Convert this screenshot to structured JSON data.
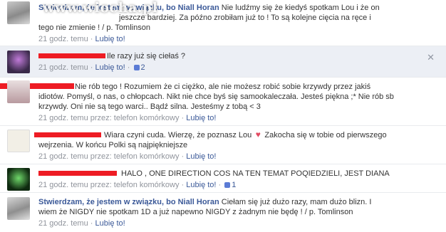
{
  "watermark": "www.wiocha.pl",
  "comments": [
    {
      "author": "Stwierdzam, że jestem w związku, bo Niall Horan",
      "text_line1": "Nie ludźmy się że kiedyś spotkam Lou i że on",
      "text_line2": "jeszcze bardziej. Za późno zrobiłam już to ! To są kolejne cięcia na ręce i",
      "text_line3": "tego nie zmienie ! / p. Tomlinson",
      "time": "21 godz. temu",
      "sep": "·",
      "like": "Lubię to!"
    },
    {
      "text": "Ile razy już się ciełaś ?",
      "time": "21 godz. temu",
      "sep": "·",
      "like": "Lubię to!",
      "likes": "2",
      "close": "✕"
    },
    {
      "text_line1": "Nie rób tego ! Rozumiem że ci ciężko, ale nie możesz robić sobie krzywdy przez jakiś",
      "text_line2": "idiotów. Pomyśl, o nas, o chłopcach. Nikt nie chce byś się samookaleczała. Jesteś piękna ;* Nie rób sb",
      "text_line3": "krzywdy. Oni nie są tego warci.. Bądź silna. Jesteśmy z tobą < 3",
      "time": "21 godz. temu przez: telefon komórkowy",
      "sep": "·",
      "like": "Lubię to!"
    },
    {
      "text_line1a": "Wiara czyni cuda. Wierzę, że poznasz Lou",
      "text_line1b": "Zakocha się w tobie od pierwszego",
      "text_line2": "wejrzenia. W końcu Polki są najpiękniejsze",
      "time": "21 godz. temu przez: telefon komórkowy",
      "sep": "·",
      "like": "Lubię to!"
    },
    {
      "text": "HALO , ONE DIRECTION COS NA TEN TEMAT POQIEDZIELI, JEST DIANA",
      "time": "21 godz. temu przez: telefon komórkowy",
      "sep": "·",
      "like": "Lubię to!",
      "likes": "1"
    },
    {
      "author": "Stwierdzam, że jestem w związku, bo Niall Horan",
      "text_line1": "Ciełam się już dużo razy, mam dużo blizn. I",
      "text_line2": "wiem że NIGDY nie spotkam 1D a już napewno NIGDY z żadnym nie będę ! / p. Tomlinson",
      "time": "21 godz. temu",
      "sep": "·",
      "like": "Lubię to!"
    }
  ],
  "colors": {
    "link": "#3b5998",
    "redaction": "#ee1c24",
    "highlight": "#eceff5"
  }
}
